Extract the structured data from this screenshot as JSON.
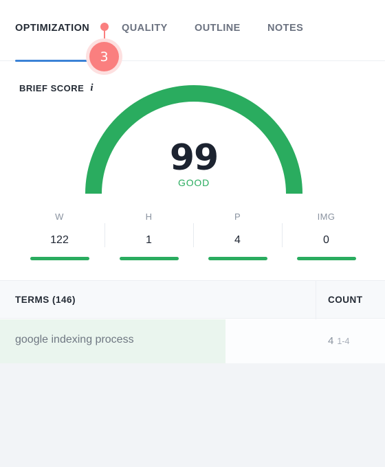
{
  "tabs": [
    {
      "label": "OPTIMIZATION",
      "active": true
    },
    {
      "label": "QUALITY",
      "active": false
    },
    {
      "label": "OUTLINE",
      "active": false
    },
    {
      "label": "NOTES",
      "active": false
    }
  ],
  "annotation_pin": {
    "number": "3",
    "color": "#fa7f7f",
    "halo_color": "#fde0e0"
  },
  "brief_score": {
    "label": "BRIEF SCORE",
    "info_icon": "info-icon",
    "value": "99",
    "status": "GOOD",
    "status_color": "#2aac5f",
    "arc_color": "#2aac5f",
    "max": "100"
  },
  "stats": [
    {
      "label": "W",
      "value": "122"
    },
    {
      "label": "H",
      "value": "1"
    },
    {
      "label": "P",
      "value": "4"
    },
    {
      "label": "IMG",
      "value": "0"
    }
  ],
  "terms_table": {
    "headers": {
      "terms": "TERMS (146)",
      "count": "COUNT"
    },
    "rows": [
      {
        "term": "google indexing process",
        "count": "4",
        "range": "1-4"
      }
    ]
  },
  "colors": {
    "accent_blue": "#3b82d6",
    "green": "#2aac5f",
    "pink": "#fa7f7f",
    "page_bg": "#f2f4f7",
    "row_highlight": "#eaf5ee"
  }
}
